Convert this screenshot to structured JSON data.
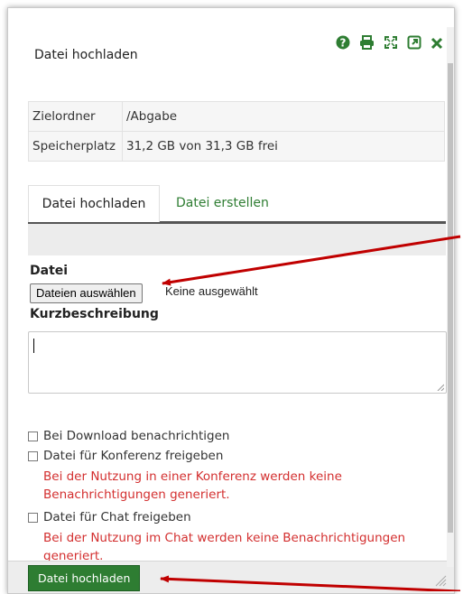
{
  "dialog": {
    "title": "Datei hochladen",
    "icons": [
      "help-icon",
      "print-icon",
      "fullscreen-icon",
      "external-link-icon",
      "close-icon"
    ]
  },
  "info": {
    "rows": [
      {
        "label": "Zielordner",
        "value": "/Abgabe"
      },
      {
        "label": "Speicherplatz",
        "value": "31,2 GB von 31,3 GB frei"
      }
    ]
  },
  "tabs": [
    {
      "label": "Datei hochladen",
      "active": true
    },
    {
      "label": "Datei erstellen",
      "active": false
    }
  ],
  "form": {
    "file_label": "Datei",
    "file_button": "Dateien auswählen",
    "file_status": "Keine ausgewählt",
    "description_label": "Kurzbeschreibung",
    "description_value": ""
  },
  "options": [
    {
      "label": "Bei Download benachrichtigen",
      "checked": false
    },
    {
      "label": "Datei für Konferenz freigeben",
      "checked": false,
      "warning": "Bei der Nutzung in einer Konferenz werden keine Benachrichtigungen generiert."
    },
    {
      "label": "Datei für Chat freigeben",
      "checked": false,
      "warning": "Bei der Nutzung im Chat werden keine Benachrichtigungen generiert."
    }
  ],
  "footer": {
    "submit_label": "Datei hochladen"
  },
  "colors": {
    "accent": "#2e7d32",
    "warning": "#d32f2f",
    "annotation_arrow": "#c00000"
  }
}
